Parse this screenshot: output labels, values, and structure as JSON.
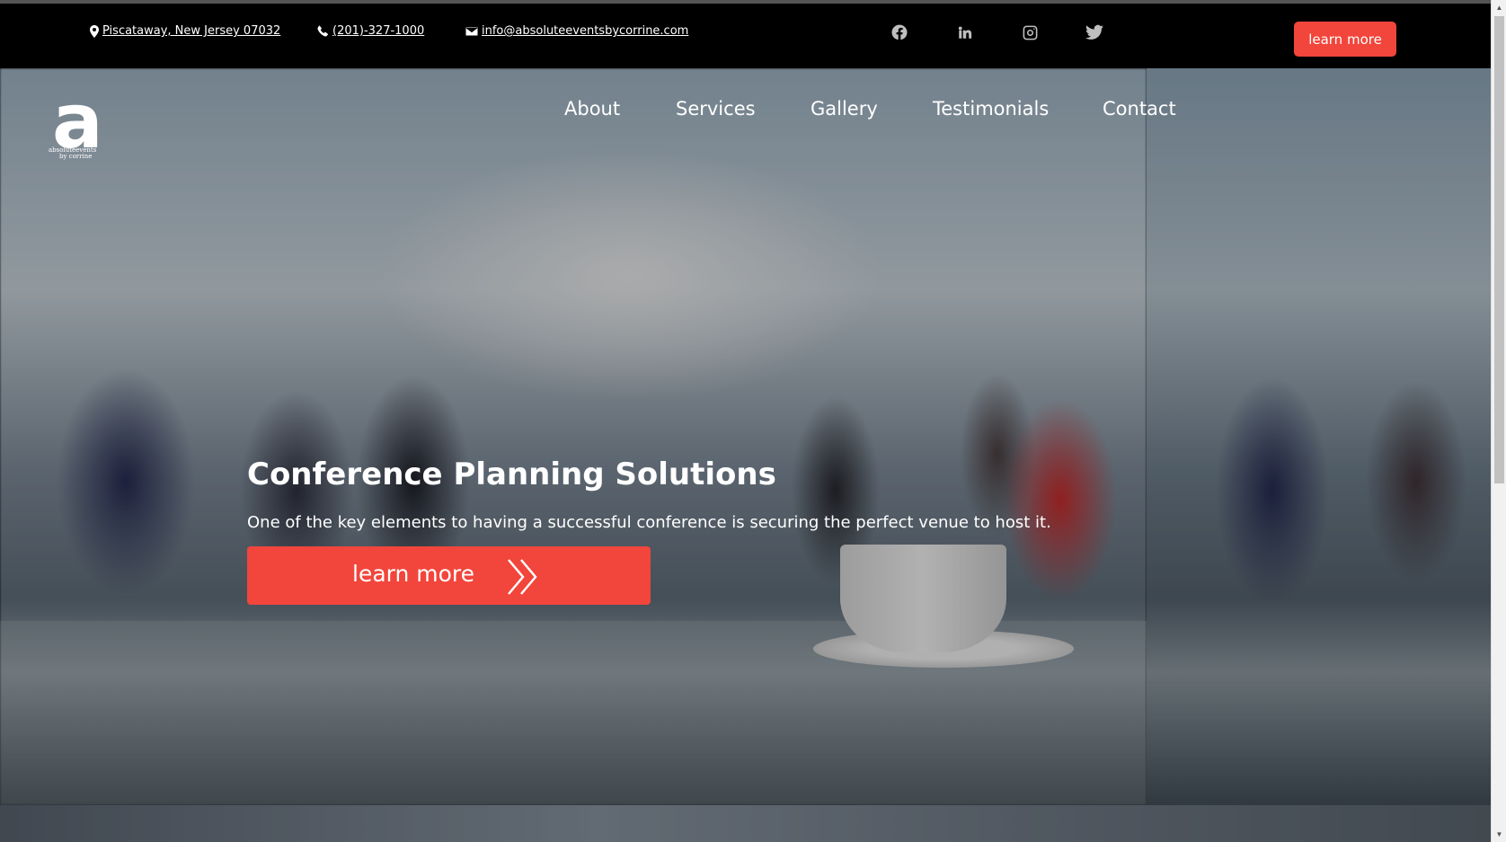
{
  "topbar": {
    "address": "Piscataway, New Jersey 07032",
    "phone": "(201)-327-1000",
    "email": "info@absoluteeventsbycorrine.com",
    "button_label": "learn more",
    "social_icons": [
      "facebook-icon",
      "linkedin-icon",
      "instagram-icon",
      "twitter-icon"
    ]
  },
  "logo": {
    "mark": "a",
    "text_line1": "absoluteevents",
    "text_line2": "by corrine"
  },
  "nav": {
    "items": [
      {
        "label": "About"
      },
      {
        "label": "Services"
      },
      {
        "label": "Gallery"
      },
      {
        "label": "Testimonials"
      },
      {
        "label": "Contact"
      }
    ]
  },
  "hero": {
    "title": "Conference Planning Solutions",
    "subtitle": "One of the key elements to having a successful conference is securing the perfect venue to host it.",
    "button_label": "learn more"
  },
  "colors": {
    "accent": "#f2453b",
    "topbar_bg": "#000000",
    "text": "#ffffff"
  }
}
